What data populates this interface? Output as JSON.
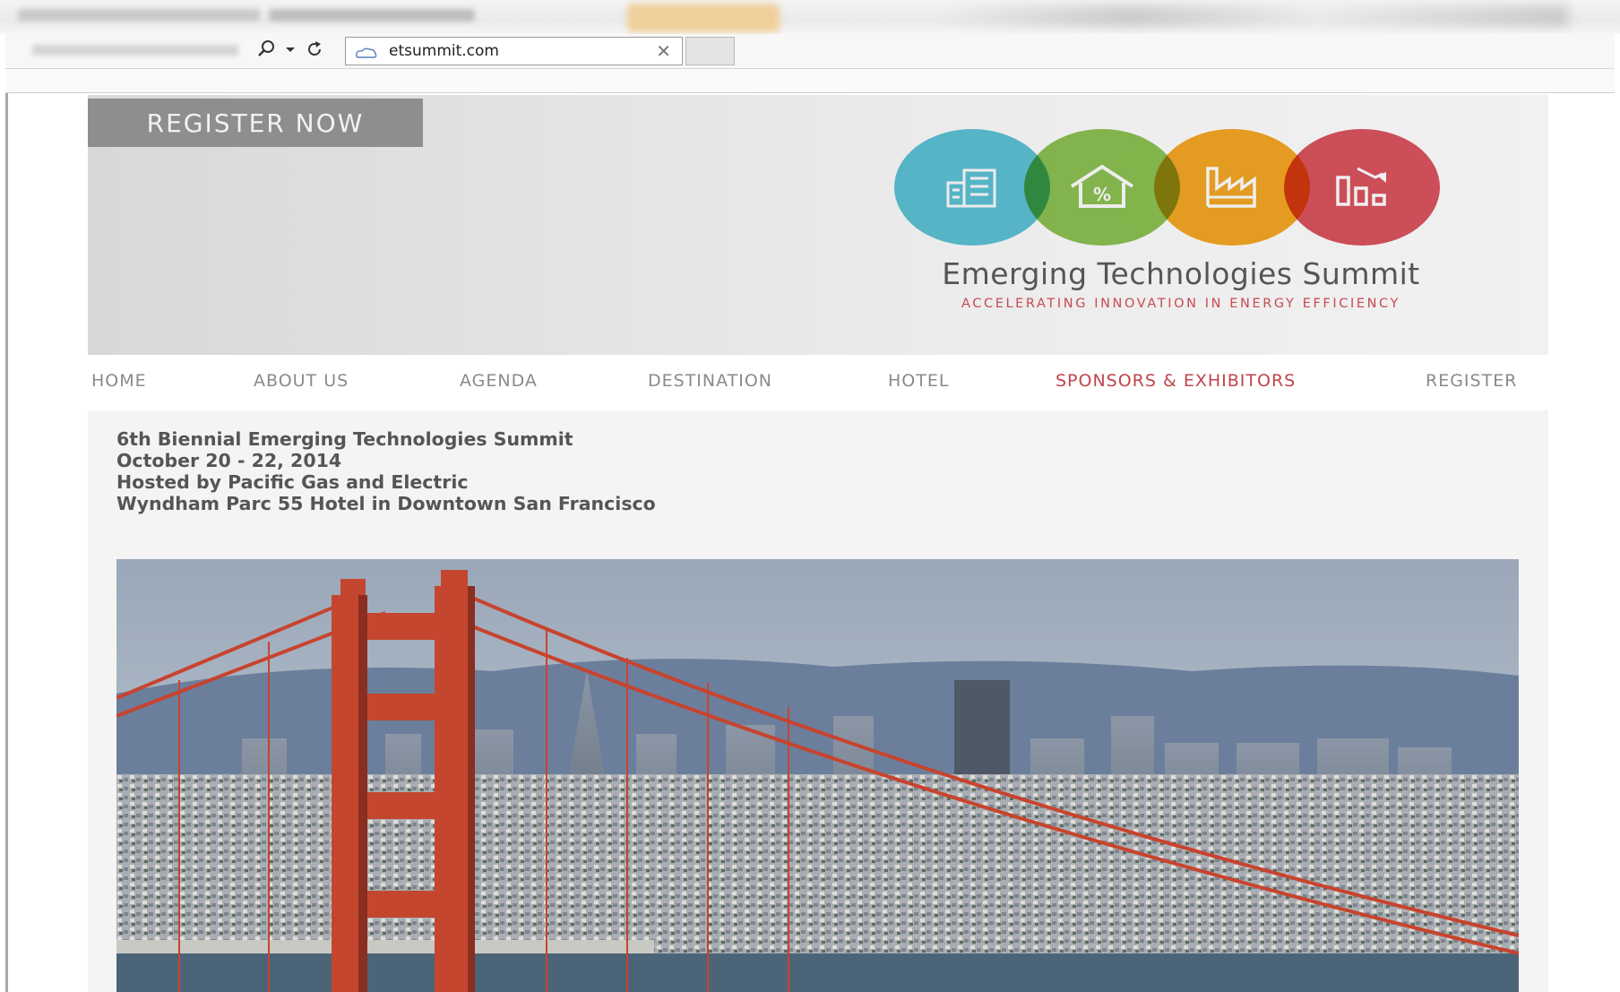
{
  "browser": {
    "address_url": "etsummit.com",
    "tool_icons": [
      "search-icon",
      "dropdown-icon",
      "refresh-icon"
    ],
    "page_icon": "cloud-page-icon",
    "close_icon": "close-icon"
  },
  "header": {
    "register_button": "REGISTER NOW",
    "logo_title": "Emerging Technologies Summit",
    "logo_subtitle": "ACCELERATING INNOVATION IN ENERGY EFFICIENCY",
    "logo_icons": [
      {
        "name": "building-icon",
        "color": "#5cc3d6"
      },
      {
        "name": "house-percent-icon",
        "color": "#8cc152"
      },
      {
        "name": "factory-icon",
        "color": "#f5a623"
      },
      {
        "name": "trend-down-icon",
        "color": "#d9535d"
      }
    ]
  },
  "nav": {
    "items": [
      {
        "label": "HOME"
      },
      {
        "label": "ABOUT US"
      },
      {
        "label": "AGENDA"
      },
      {
        "label": "DESTINATION"
      },
      {
        "label": "HOTEL"
      },
      {
        "label": "SPONSORS & EXHIBITORS",
        "active": true
      },
      {
        "label": "REGISTER"
      }
    ],
    "active_color": "#c0444c",
    "text_color": "#8a8a8a"
  },
  "event": {
    "line1": "6th Biennial Emerging Technologies Summit",
    "line2": "October 20 - 22, 2014",
    "line3": "Hosted by Pacific Gas and Electric",
    "line4": "Wyndham Parc 55 Hotel in Downtown San Francisco"
  },
  "hero": {
    "subject": "golden-gate-bridge-photo"
  }
}
